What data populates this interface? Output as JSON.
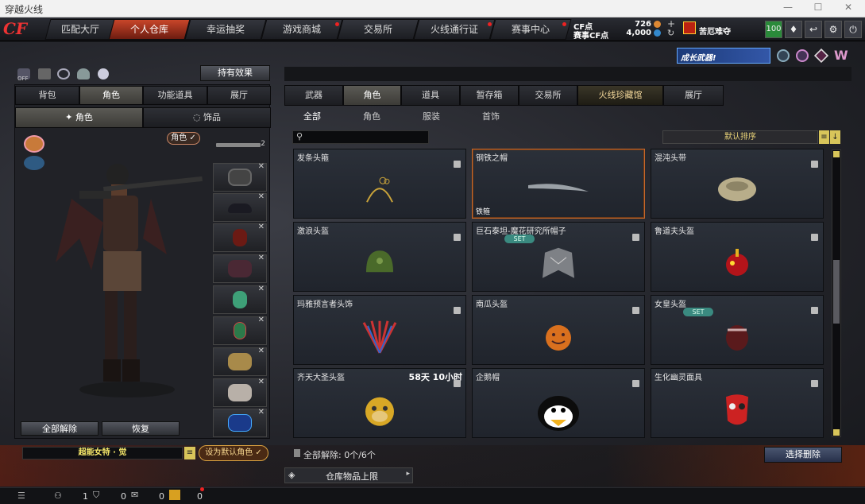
{
  "window": {
    "title": "穿越火线"
  },
  "nav": {
    "tabs": [
      {
        "label": "匹配大厅"
      },
      {
        "label": "个人仓库"
      },
      {
        "label": "幸运抽奖"
      },
      {
        "label": "游戏商城"
      },
      {
        "label": "交易所"
      },
      {
        "label": "火线通行证"
      },
      {
        "label": "赛事中心"
      }
    ]
  },
  "account": {
    "cf_label": "CF点",
    "cf_value": "726",
    "match_label": "赛事CF点",
    "match_value": "4,000",
    "clan": "苦厄难夺",
    "level": "100"
  },
  "banner": {
    "text": "成长武器!"
  },
  "left": {
    "effects_button": "持有效果",
    "tabs": [
      {
        "label": "背包"
      },
      {
        "label": "角色"
      },
      {
        "label": "功能道具"
      },
      {
        "label": "展厅"
      }
    ],
    "subtabs": [
      {
        "label": "角色"
      },
      {
        "label": "饰品"
      }
    ],
    "role_badge": "角色",
    "count": "2",
    "unequip_all": "全部解除",
    "restore": "恢复",
    "char_name": "超能女特 · 觉",
    "set_default": "设为默认角色",
    "off": "OFF"
  },
  "right": {
    "tabs": [
      {
        "label": "武器"
      },
      {
        "label": "角色"
      },
      {
        "label": "道具"
      },
      {
        "label": "暂存箱"
      },
      {
        "label": "交易所"
      },
      {
        "label": "火线珍藏馆"
      },
      {
        "label": "展厅"
      }
    ],
    "filters": [
      {
        "label": "全部"
      },
      {
        "label": "角色"
      },
      {
        "label": "服装"
      },
      {
        "label": "首饰"
      }
    ],
    "search_placeholder": "",
    "sort": "默认排序",
    "items": [
      {
        "name": "发条头箍",
        "time": "",
        "set": ""
      },
      {
        "name": "钢铁之帽",
        "time": "",
        "set": "",
        "tag": "铁箍"
      },
      {
        "name": "混沌头带",
        "time": "",
        "set": ""
      },
      {
        "name": "激浪头盔",
        "time": "",
        "set": ""
      },
      {
        "name": "巨石泰坦-魔花研究所帽子",
        "time": "",
        "set": "SET"
      },
      {
        "name": "鲁道夫头盔",
        "time": "",
        "set": ""
      },
      {
        "name": "玛雅预言者头饰",
        "time": "",
        "set": ""
      },
      {
        "name": "南瓜头盔",
        "time": "",
        "set": ""
      },
      {
        "name": "女皇头盔",
        "time": "",
        "set": "SET"
      },
      {
        "name": "齐天大圣头盔",
        "time": "58天 10小时",
        "set": ""
      },
      {
        "name": "企鹅帽",
        "time": "",
        "set": ""
      },
      {
        "name": "生化幽灵面具",
        "time": "",
        "set": ""
      }
    ],
    "unequip_label": "全部解除:",
    "unequip_count": "0个/6个",
    "select_delete": "选择删除",
    "capacity": "仓库物品上限"
  },
  "bottom": {
    "v1": "1",
    "v2": "0",
    "v3": "0",
    "v4": "0"
  }
}
